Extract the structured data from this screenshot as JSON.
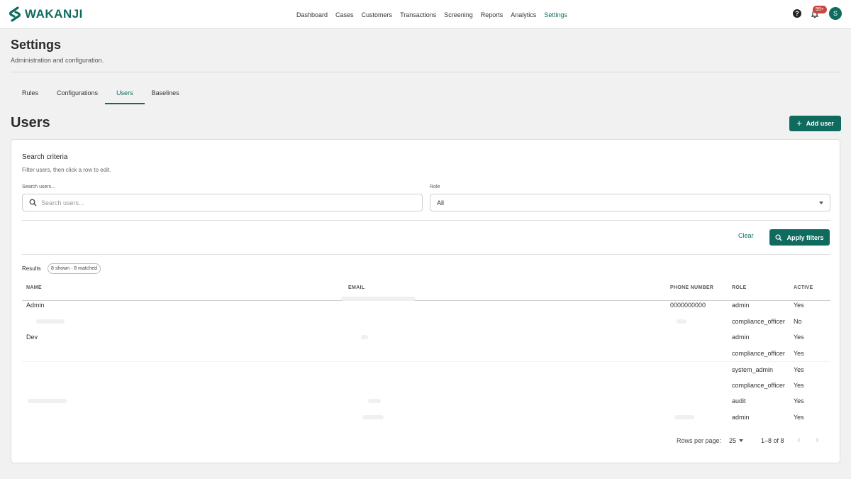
{
  "header": {
    "brand": "WAKANJI",
    "nav": [
      {
        "label": "Dashboard"
      },
      {
        "label": "Cases"
      },
      {
        "label": "Customers"
      },
      {
        "label": "Transactions"
      },
      {
        "label": "Screening"
      },
      {
        "label": "Reports"
      },
      {
        "label": "Analytics"
      },
      {
        "label": "Settings"
      }
    ],
    "help_icon": "help-circle-icon",
    "notification_badge": "99+",
    "avatar_initial": "S"
  },
  "page": {
    "title": "Settings",
    "subtitle": "Administration and configuration.",
    "tabs": [
      {
        "label": "Rules"
      },
      {
        "label": "Configurations"
      },
      {
        "label": "Users"
      },
      {
        "label": "Baselines"
      }
    ],
    "active_tab": "Users"
  },
  "users_section": {
    "title": "Users",
    "add_user_label": "Add user"
  },
  "search_criteria": {
    "title": "Search criteria",
    "subtitle": "Filter users, then click a row to edit.",
    "search_label": "Search users...",
    "search_placeholder": "Search users...",
    "search_value": "",
    "role_label": "Role",
    "role_value": "All",
    "clear_label": "Clear",
    "apply_label": "Apply filters"
  },
  "results": {
    "label": "Results",
    "pill": "8 shown · 8 matched",
    "columns": {
      "name": "NAME",
      "email": "EMAIL",
      "phone": "PHONE NUMBER",
      "role": "ROLE",
      "active": "ACTIVE"
    },
    "rows": [
      {
        "name": "Admin",
        "email": "",
        "phone": "0000000000",
        "role": "admin",
        "active": "Yes"
      },
      {
        "name": "",
        "email": "",
        "phone": "",
        "role": "compliance_officer",
        "active": "No"
      },
      {
        "name": "Dev",
        "email": "",
        "phone": "",
        "role": "admin",
        "active": "Yes"
      },
      {
        "name": "",
        "email": "",
        "phone": "",
        "role": "compliance_officer",
        "active": "Yes"
      },
      {
        "name": "",
        "email": "",
        "phone": "",
        "role": "system_admin",
        "active": "Yes"
      },
      {
        "name": "",
        "email": "",
        "phone": "",
        "role": "compliance_officer",
        "active": "Yes"
      },
      {
        "name": "",
        "email": "",
        "phone": "",
        "role": "audit",
        "active": "Yes"
      },
      {
        "name": "",
        "email": "",
        "phone": "",
        "role": "admin",
        "active": "Yes"
      }
    ]
  },
  "pagination": {
    "rows_per_page_label": "Rows per page:",
    "rows_per_page_value": "25",
    "range": "1–8 of 8"
  },
  "colors": {
    "brand": "#0f6b5e",
    "badge": "#c9473f"
  }
}
